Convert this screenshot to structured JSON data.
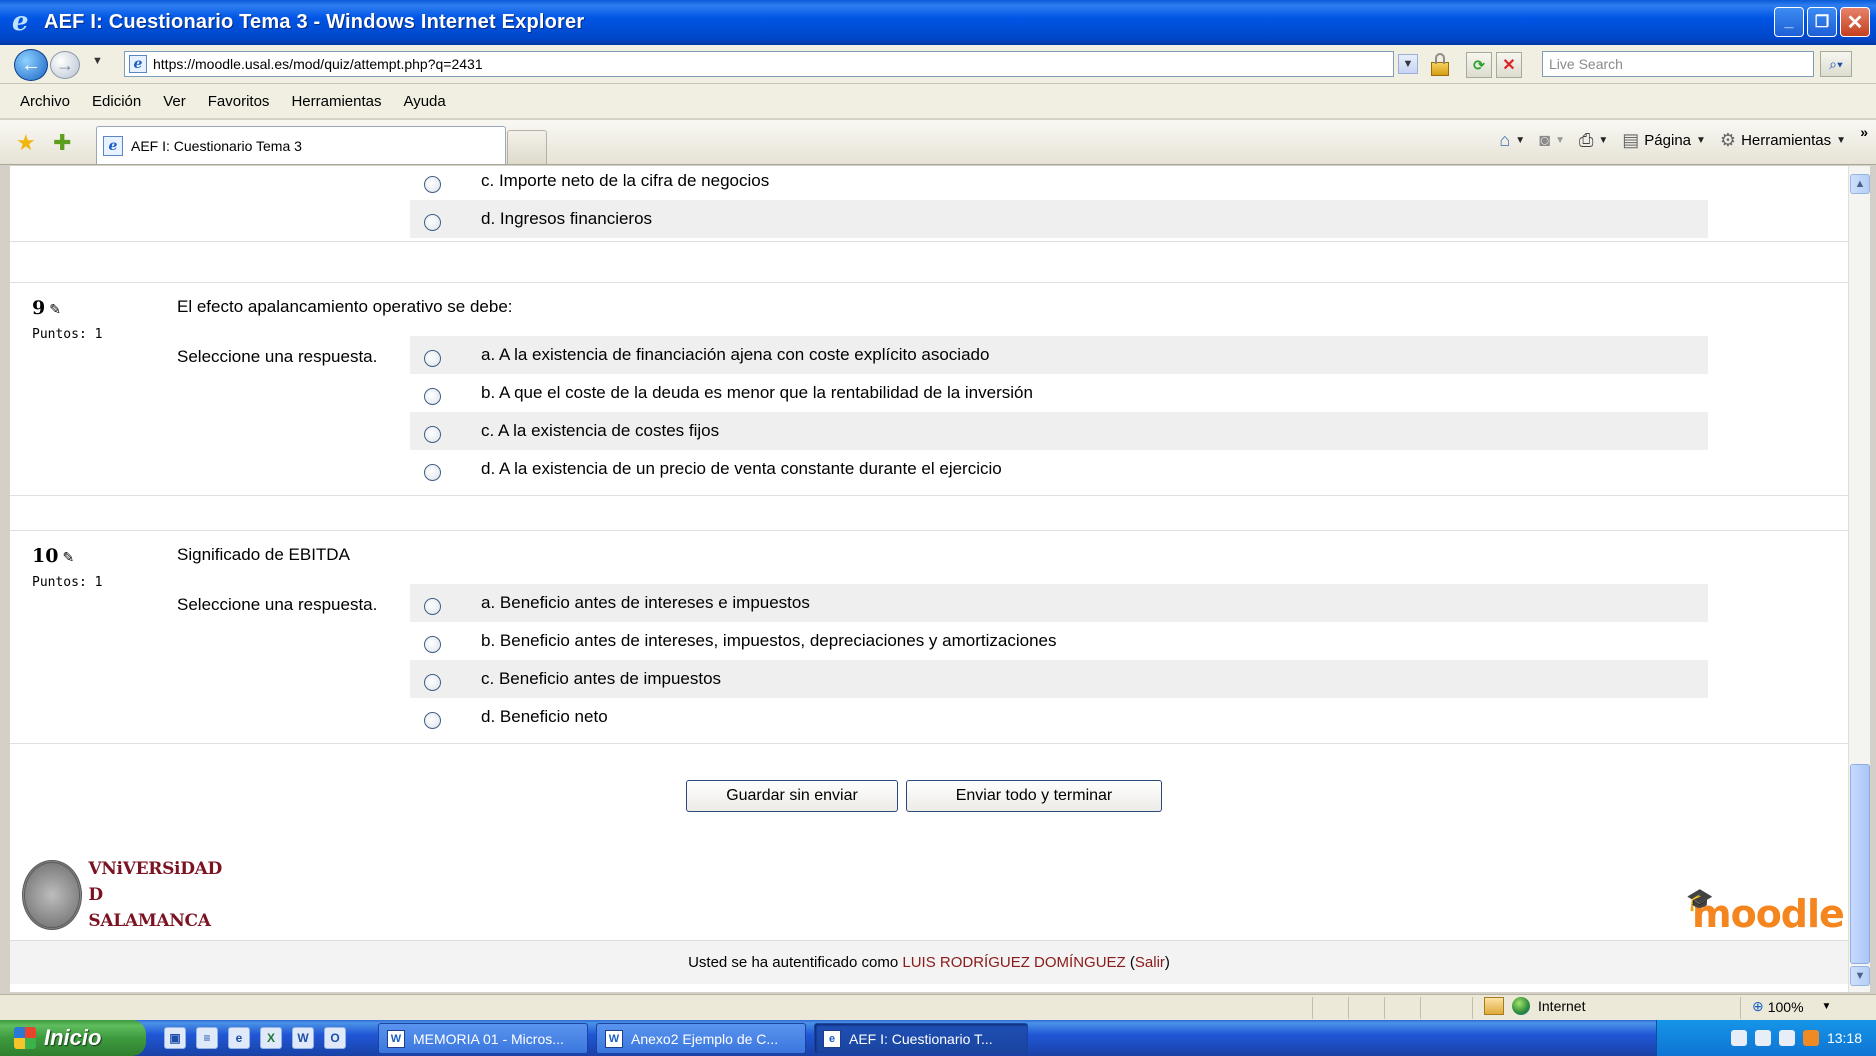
{
  "window": {
    "title": "AEF I: Cuestionario Tema 3 - Windows Internet Explorer",
    "controls": [
      "minimize",
      "restore",
      "close"
    ]
  },
  "address_bar": {
    "url": "https://moodle.usal.es/mod/quiz/attempt.php?q=2431",
    "search_placeholder": "Live Search"
  },
  "menu": [
    "Archivo",
    "Edición",
    "Ver",
    "Favoritos",
    "Herramientas",
    "Ayuda"
  ],
  "tabs": {
    "active_label": "AEF I: Cuestionario Tema 3"
  },
  "command_bar": {
    "page_label": "Página",
    "tools_label": "Herramientas"
  },
  "quiz": {
    "prev_options": [
      {
        "letter": "c.",
        "text": "c. Importe neto de la cifra de negocios"
      },
      {
        "letter": "d.",
        "text": "d. Ingresos financieros"
      }
    ],
    "questions": [
      {
        "number": "9",
        "points": "Puntos: 1",
        "text": "El efecto apalancamiento operativo se debe:",
        "prompt": "Seleccione una respuesta.",
        "options": [
          "a. A la existencia de financiación ajena con coste explícito asociado",
          "b. A que el coste de la deuda es menor que la rentabilidad de la inversión",
          "c. A la existencia de costes fijos",
          "d. A la existencia de un precio de venta constante durante el ejercicio"
        ]
      },
      {
        "number": "10",
        "points": "Puntos: 1",
        "text": "Significado de EBITDA",
        "prompt": "Seleccione una respuesta.",
        "options": [
          "a. Beneficio antes de intereses e impuestos",
          "b. Beneficio antes de intereses, impuestos, depreciaciones y amortizaciones",
          "c. Beneficio antes de impuestos",
          "d. Beneficio neto"
        ]
      }
    ],
    "save_button": "Guardar sin enviar",
    "submit_button": "Enviar todo y terminar"
  },
  "branding": {
    "university_line1": "VNiVERSiDAD",
    "university_line2": "D SALAMANCA",
    "moodle": "moodle"
  },
  "footer": {
    "prefix": "Usted se ha autentificado como ",
    "user": "LUIS RODRÍGUEZ DOMÍNGUEZ",
    "open_paren": " (",
    "logout": "Salir",
    "close_paren": ")"
  },
  "status_bar": {
    "zone": "Internet",
    "zoom": "100%"
  },
  "taskbar": {
    "start": "Inicio",
    "tasks": [
      "MEMORIA 01 - Micros...",
      "Anexo2 Ejemplo de C...",
      "AEF I: Cuestionario T..."
    ],
    "clock": "13:18"
  },
  "colors": {
    "titlebar": "#0055e5",
    "footer_user": "#8b1a1a",
    "moodle_orange": "#f5861f",
    "usal_red": "#7b1323"
  }
}
